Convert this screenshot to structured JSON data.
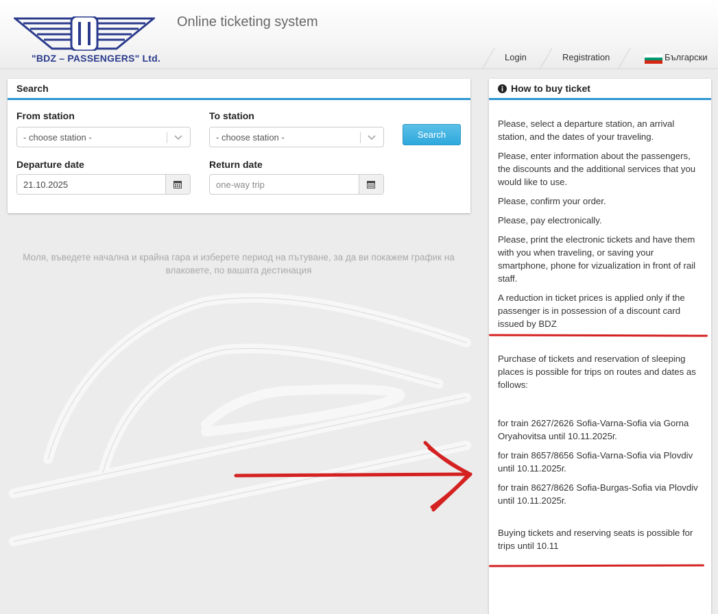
{
  "header": {
    "company": "\"BDZ – PASSENGERS\" Ltd.",
    "app_title": "Online ticketing system",
    "nav": {
      "login": "Login",
      "registration": "Registration",
      "language": "Български"
    }
  },
  "search": {
    "title": "Search",
    "from_label": "From station",
    "from_value": "- choose station -",
    "to_label": "To station",
    "to_value": "- choose station -",
    "departure_label": "Departure date",
    "departure_value": "21.10.2025",
    "return_label": "Return date",
    "return_placeholder": "one-way trip",
    "search_button": "Search"
  },
  "hint": "Моля, въведете начална и крайна гара и изберете период на пътуване, за да ви покажем график на влаковете, по вашата дестинация",
  "info": {
    "title": "How to buy ticket",
    "steps": [
      "Please, select a departure station, an arrival station, and the dates of your traveling.",
      "Please, enter information about the passengers, the discounts and the additional services that you would like to use.",
      "Please, confirm your order.",
      "Please, pay electronically.",
      "Please, print the electronic tickets and have them with you when traveling, or saving your smartphone, phone for vizualization in front of rail staff.",
      "A reduction in ticket prices is applied only if the passenger is in possession of a discount card issued by BDZ"
    ],
    "purchase_intro": "Purchase of tickets and reservation of sleeping places is possible for trips on routes and dates as follows:",
    "trains": [
      "for train 2627/2626 Sofia-Varna-Sofia via Gorna Oryahovitsa until  10.11.2025г.",
      "for train 8657/8656 Sofia-Varna-Sofia via Plovdiv until  10.11.2025г.",
      "for train 8627/8626 Sofia-Burgas-Sofia via Plovdiv until   10.11.2025г."
    ],
    "seats_note": "Buying tickets and reserving seats is possible for trips until  10.11",
    "footer": "--"
  },
  "colors": {
    "accent": "#2a95d1",
    "brand": "#2a3a8c",
    "annotation": "#d42121"
  }
}
